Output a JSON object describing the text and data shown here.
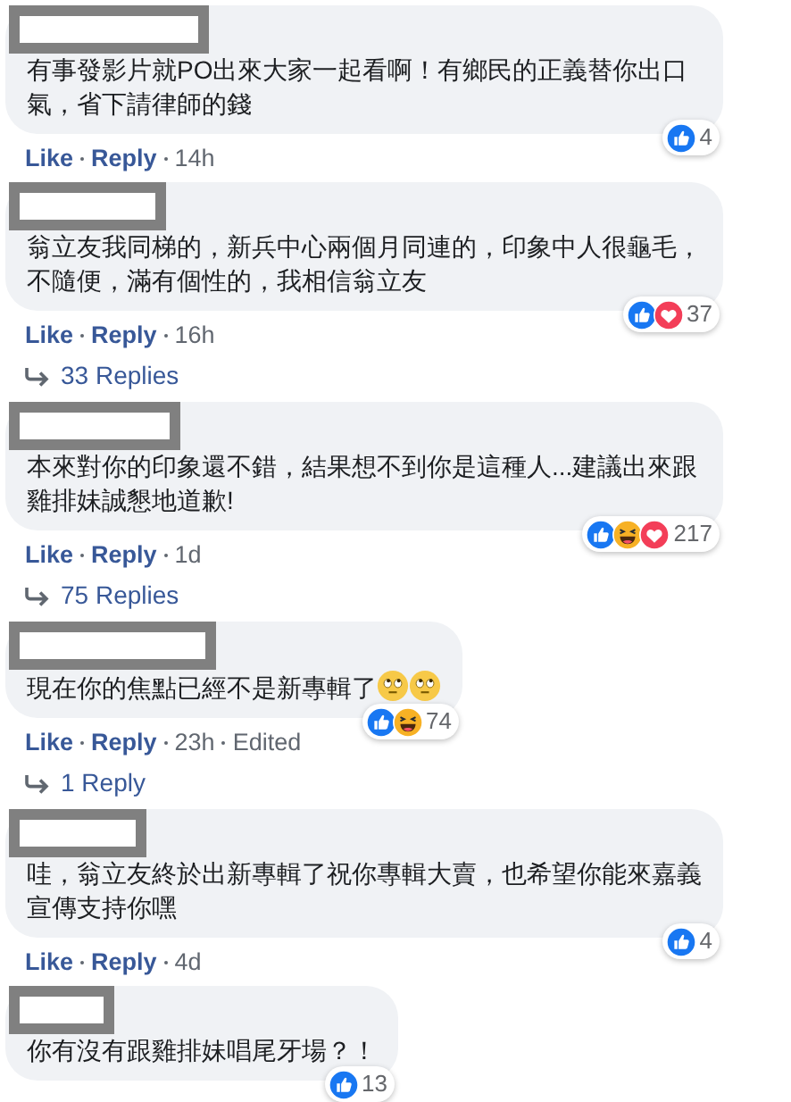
{
  "comments": [
    {
      "text": "有事發影片就PO出來大家一起看啊！有鄉民的正義替你出口氣，省下請律師的錢",
      "reactions": [
        {
          "kind": "like"
        }
      ],
      "reaction_count": "4",
      "like": "Like",
      "reply": "Reply",
      "time": "14h"
    },
    {
      "text": "翁立友我同梯的，新兵中心兩個月同連的，印象中人很龜毛，不隨便，滿有個性的，我相信翁立友",
      "reactions": [
        {
          "kind": "like"
        },
        {
          "kind": "love"
        }
      ],
      "reaction_count": "37",
      "like": "Like",
      "reply": "Reply",
      "time": "16h",
      "replies": "33 Replies"
    },
    {
      "text": "本來對你的印象還不錯，結果想不到你是這種人...建議出來跟雞排妹誠懇地道歉!",
      "reactions": [
        {
          "kind": "like"
        },
        {
          "kind": "haha"
        },
        {
          "kind": "love"
        }
      ],
      "reaction_count": "217",
      "like": "Like",
      "reply": "Reply",
      "time": "1d",
      "replies": "75 Replies"
    },
    {
      "text": "現在你的焦點已經不是新專輯了",
      "text_emoji": [
        {
          "kind": "rolling-eyes"
        },
        {
          "kind": "rolling-eyes"
        }
      ],
      "reactions": [
        {
          "kind": "like"
        },
        {
          "kind": "haha"
        }
      ],
      "reaction_count": "74",
      "like": "Like",
      "reply": "Reply",
      "time": "23h",
      "edited": "Edited",
      "replies": "1 Reply"
    },
    {
      "text": "哇，翁立友終於出新專輯了祝你專輯大賣，也希望你能來嘉義宣傳支持你嘿",
      "reactions": [
        {
          "kind": "like"
        }
      ],
      "reaction_count": "4",
      "like": "Like",
      "reply": "Reply",
      "time": "4d"
    },
    {
      "text": "你有沒有跟雞排妹唱尾牙場？！",
      "reactions": [
        {
          "kind": "like"
        }
      ],
      "reaction_count": "13"
    }
  ]
}
